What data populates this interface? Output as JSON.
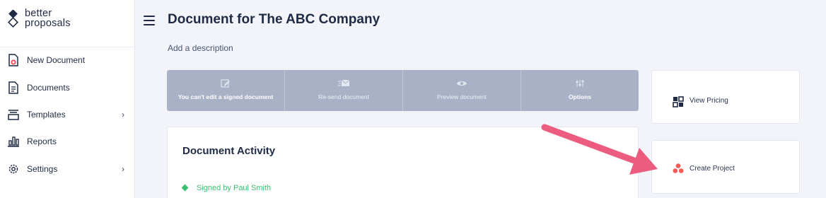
{
  "brand": {
    "line1": "better",
    "line2": "proposals"
  },
  "sidebar": {
    "items": [
      {
        "label": "New Document",
        "icon": "new-document-icon",
        "has_submenu": false
      },
      {
        "label": "Documents",
        "icon": "documents-icon",
        "has_submenu": false
      },
      {
        "label": "Templates",
        "icon": "templates-icon",
        "has_submenu": true
      },
      {
        "label": "Reports",
        "icon": "reports-icon",
        "has_submenu": true
      },
      {
        "label": "Settings",
        "icon": "settings-icon",
        "has_submenu": true
      }
    ],
    "chevron": "›"
  },
  "header": {
    "title": "Document for The ABC Company",
    "description_placeholder": "Add a description"
  },
  "actions": [
    {
      "label": "You can't edit a signed document",
      "icon": "edit-icon"
    },
    {
      "label": "Re-send document",
      "icon": "send-email-icon"
    },
    {
      "label": "Preview document",
      "icon": "eye-icon"
    },
    {
      "label": "Options",
      "icon": "options-sliders-icon"
    }
  ],
  "activity": {
    "title": "Document Activity",
    "items": [
      {
        "text": "Signed by Paul Smith",
        "status_color": "#38c172"
      }
    ]
  },
  "side_cards": {
    "pricing_label": "View Pricing",
    "project_label": "Create Project"
  },
  "colors": {
    "accent_arrow": "#ec5c7e",
    "action_bar": "#a9b1c6",
    "success": "#38c172",
    "project_icon": "#f25c54"
  }
}
